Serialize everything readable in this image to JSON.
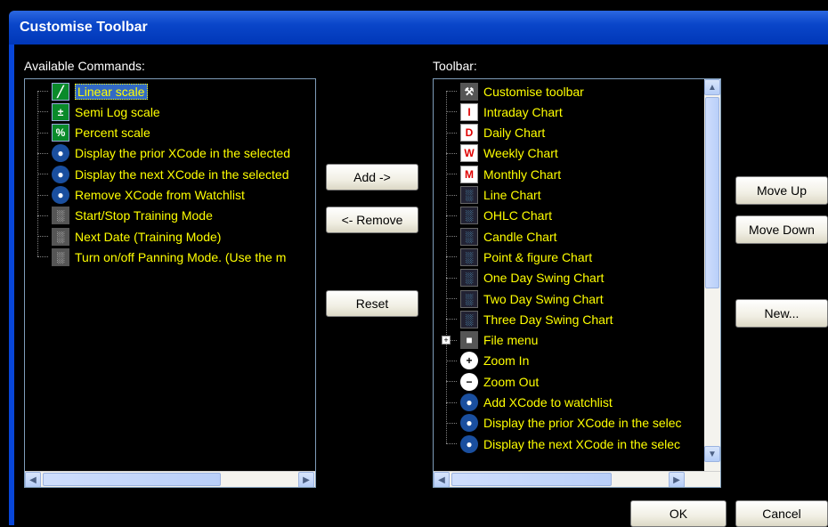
{
  "window": {
    "title": "Customise Toolbar"
  },
  "available": {
    "label": "Available Commands:",
    "items": [
      {
        "label": "Linear scale",
        "icon": "linear-scale-icon",
        "selected": true
      },
      {
        "label": "Semi Log scale",
        "icon": "semi-log-scale-icon"
      },
      {
        "label": "Percent scale",
        "icon": "percent-scale-icon"
      },
      {
        "label": "Display the prior XCode in the selected",
        "icon": "prior-xcode-icon"
      },
      {
        "label": "Display the next XCode in the selected",
        "icon": "next-xcode-icon"
      },
      {
        "label": "Remove XCode from Watchlist",
        "icon": "remove-xcode-icon"
      },
      {
        "label": "Start/Stop Training Mode",
        "icon": "training-mode-icon"
      },
      {
        "label": "Next Date (Training Mode)",
        "icon": "next-date-icon"
      },
      {
        "label": "Turn on/off Panning Mode.  (Use the m",
        "icon": "panning-mode-icon"
      }
    ]
  },
  "toolbar": {
    "label": "Toolbar:",
    "items": [
      {
        "label": "Customise toolbar",
        "icon": "customise-icon"
      },
      {
        "label": "Intraday Chart",
        "icon": "intraday-chart-icon",
        "glyph": "I"
      },
      {
        "label": "Daily Chart",
        "icon": "daily-chart-icon",
        "glyph": "D"
      },
      {
        "label": "Weekly Chart",
        "icon": "weekly-chart-icon",
        "glyph": "W"
      },
      {
        "label": "Monthly Chart",
        "icon": "monthly-chart-icon",
        "glyph": "M"
      },
      {
        "label": "Line Chart",
        "icon": "line-chart-icon"
      },
      {
        "label": "OHLC Chart",
        "icon": "ohlc-chart-icon"
      },
      {
        "label": "Candle Chart",
        "icon": "candle-chart-icon"
      },
      {
        "label": "Point & figure Chart",
        "icon": "point-figure-chart-icon"
      },
      {
        "label": "One Day Swing Chart",
        "icon": "one-day-swing-icon"
      },
      {
        "label": "Two Day Swing Chart",
        "icon": "two-day-swing-icon"
      },
      {
        "label": "Three Day Swing Chart",
        "icon": "three-day-swing-icon"
      },
      {
        "label": "File menu",
        "icon": "file-menu-icon",
        "expandable": true
      },
      {
        "label": "Zoom In",
        "icon": "zoom-in-icon"
      },
      {
        "label": "Zoom Out",
        "icon": "zoom-out-icon"
      },
      {
        "label": "Add XCode to watchlist",
        "icon": "add-xcode-icon"
      },
      {
        "label": "Display the prior XCode in the selec",
        "icon": "prior-xcode-icon"
      },
      {
        "label": "Display the next XCode in the selec",
        "icon": "next-xcode-icon"
      }
    ]
  },
  "buttons": {
    "add": "Add ->",
    "remove": "<- Remove",
    "reset": "Reset",
    "move_up": "Move Up",
    "move_down": "Move Down",
    "new": "New...",
    "ok": "OK",
    "cancel": "Cancel"
  },
  "colors": {
    "item_text": "#ffff00",
    "selection": "#316ac5",
    "title_bar": "#0a46c9"
  }
}
